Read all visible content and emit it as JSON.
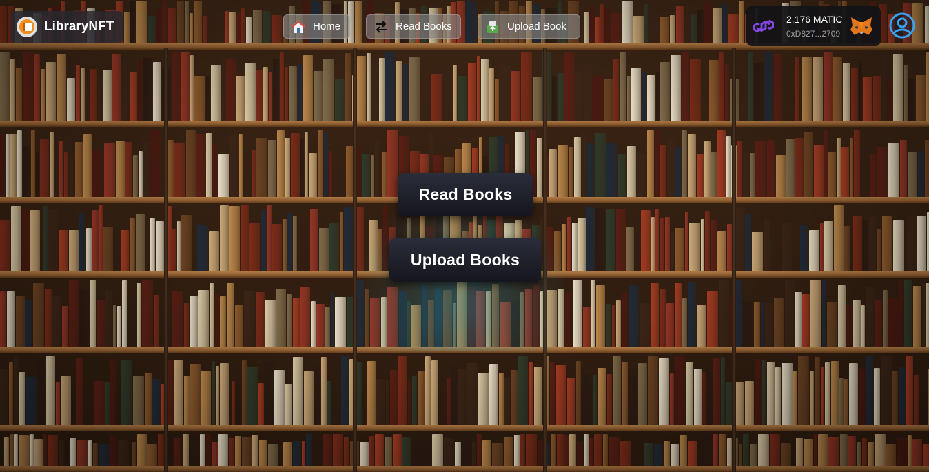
{
  "brand": {
    "name": "LibraryNFT"
  },
  "nav": {
    "home_label": "Home",
    "read_label": "Read Books",
    "upload_label": "Upload Book"
  },
  "wallet": {
    "balance": "2.176 MATIC",
    "address": "0xD827...2709"
  },
  "actions": {
    "read_label": "Read Books",
    "upload_label": "Upload Books"
  },
  "colors": {
    "matic": "#8247e5",
    "profile": "#3aa0f0",
    "brand_logo": "#f28c1a"
  },
  "icons": {
    "brand": "library-book-icon",
    "home": "home-icon",
    "read": "swap-arrows-icon",
    "upload": "upload-book-icon",
    "wallet_chain": "polygon-icon",
    "wallet_provider": "metamask-fox-icon",
    "profile": "user-profile-icon"
  }
}
